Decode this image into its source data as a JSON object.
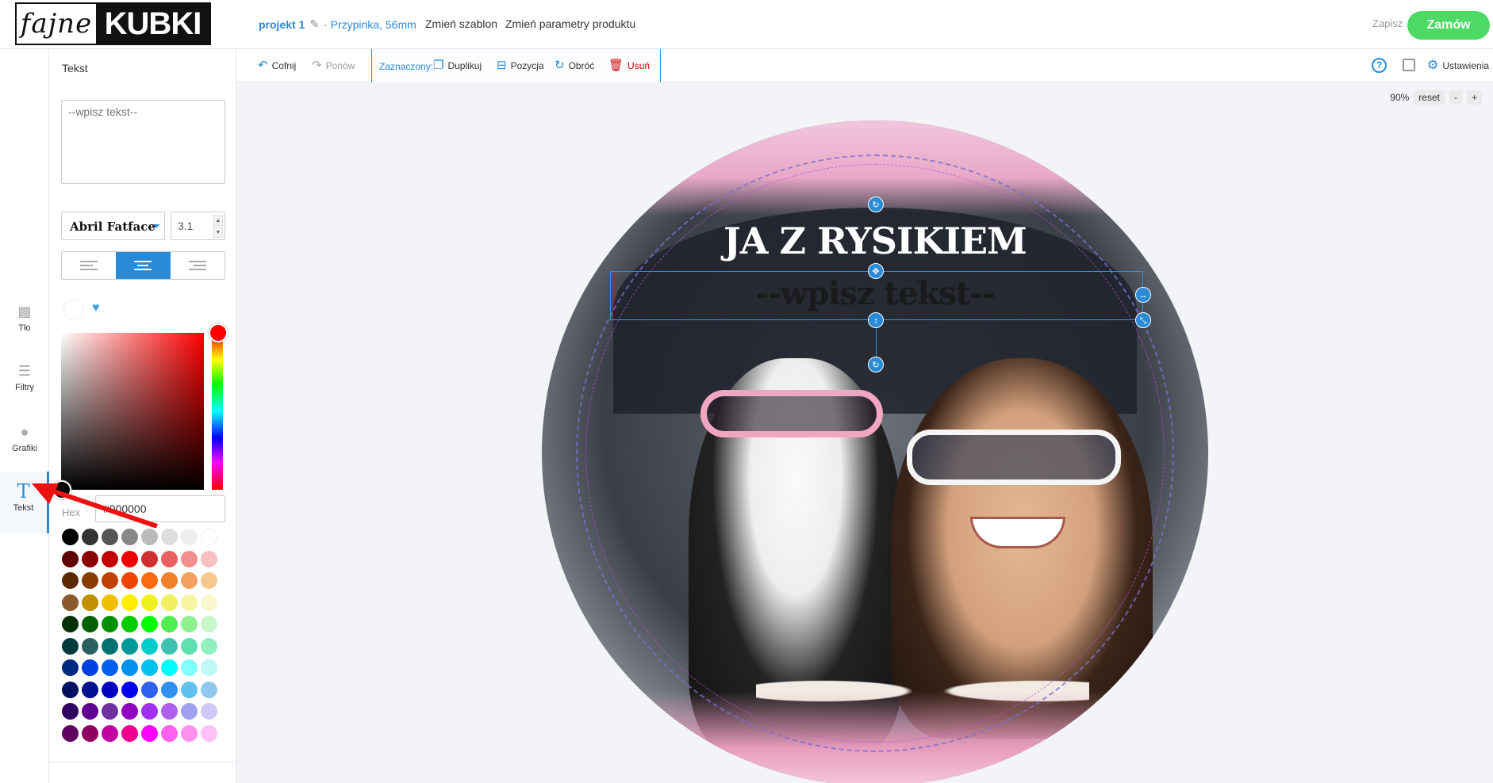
{
  "header": {
    "logo_left": "fajne",
    "logo_right": "KUBKI",
    "project_name": "projekt 1",
    "project_desc": "· Przypinka, 56mm",
    "change_template": "Zmień szablon",
    "change_params": "Zmień parametry produktu",
    "save": "Zapisz",
    "order": "Zamów"
  },
  "rail": {
    "items": [
      {
        "label": "Tło",
        "icon": "background-icon"
      },
      {
        "label": "Filtry",
        "icon": "sliders-icon"
      },
      {
        "label": "Grafiki",
        "icon": "drop-icon"
      },
      {
        "label": "Tekst",
        "icon": "text-icon"
      }
    ]
  },
  "panel": {
    "title": "Tekst",
    "text_placeholder": "--wpisz tekst--",
    "font": "Abril Fatface",
    "font_size": "3.1",
    "hex_label": "Hex",
    "hex_value": "#000000",
    "palette": [
      [
        "#000000",
        "#333333",
        "#555555",
        "#888888",
        "#bbbbbb",
        "#dddddd",
        "#eeeeee",
        "#ffffff"
      ],
      [
        "#5e0000",
        "#8a0000",
        "#c10000",
        "#ee0000",
        "#d03030",
        "#e86060",
        "#f29090",
        "#f8c0c0"
      ],
      [
        "#5c2800",
        "#8a3c00",
        "#c04000",
        "#ee4400",
        "#ff6a10",
        "#f0802a",
        "#f4a060",
        "#f8c890"
      ],
      [
        "#8a5a2a",
        "#c09000",
        "#f0c000",
        "#ffee00",
        "#f0f020",
        "#f2f060",
        "#f6f4a0",
        "#faf8d0"
      ],
      [
        "#003000",
        "#006000",
        "#009000",
        "#00cc00",
        "#00ff00",
        "#50ee50",
        "#90f090",
        "#c8f8c8"
      ],
      [
        "#003a3a",
        "#2a6060",
        "#007070",
        "#009999",
        "#00cccc",
        "#40c0b0",
        "#60e0b0",
        "#90f0c0"
      ],
      [
        "#002a80",
        "#0040e0",
        "#0060ee",
        "#0090ee",
        "#00c0ee",
        "#00ffff",
        "#80ffff",
        "#c0f8f8"
      ],
      [
        "#001060",
        "#001090",
        "#0000c0",
        "#0000ee",
        "#3060ee",
        "#3090ee",
        "#60c0f0",
        "#90c8f0"
      ],
      [
        "#300060",
        "#600090",
        "#7030a0",
        "#9000c0",
        "#a030ee",
        "#b060ee",
        "#a0a0f0",
        "#d0c8f8"
      ],
      [
        "#600060",
        "#900060",
        "#c000a0",
        "#ee0090",
        "#ff00ff",
        "#ff60f0",
        "#ff90f0",
        "#ffc0f8"
      ]
    ]
  },
  "toolbar": {
    "undo": "Cofnij",
    "redo": "Ponów",
    "selected": "Zaznaczony:",
    "duplicate": "Duplikuj",
    "position": "Pozycja",
    "rotate": "Obróć",
    "delete": "Usuń",
    "settings": "Ustawienia"
  },
  "canvas": {
    "zoom": "90%",
    "reset": "reset",
    "minus": "-",
    "plus": "+",
    "title_text": "JA Z RYSIKIEM",
    "placeholder_text": "--wpisz tekst--"
  },
  "colors": {
    "accent": "#2a8ad6",
    "order_button": "#4cd964",
    "delete": "#cc0000"
  }
}
